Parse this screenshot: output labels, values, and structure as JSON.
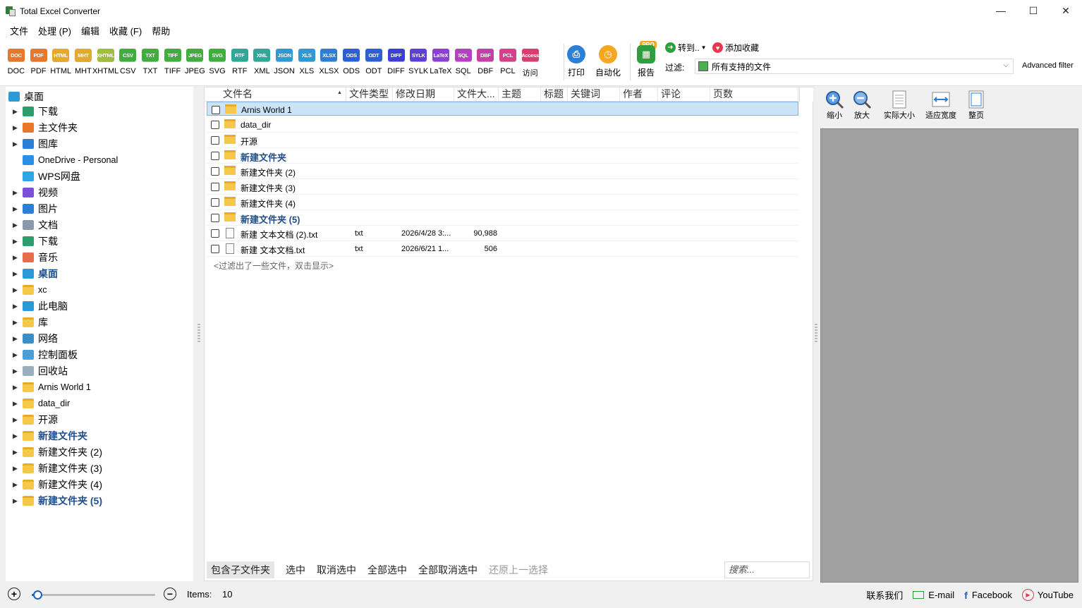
{
  "window": {
    "title": "Total Excel Converter",
    "minimize": "—",
    "maximize": "☐",
    "close": "✕"
  },
  "menu": [
    "文件",
    "处理 (P)",
    "编辑",
    "收藏 (F)",
    "帮助"
  ],
  "formats": [
    {
      "label": "DOC",
      "color": "#e8762b"
    },
    {
      "label": "PDF",
      "color": "#e8762b"
    },
    {
      "label": "HTML",
      "color": "#e8a82b"
    },
    {
      "label": "MHT",
      "color": "#e8a82b"
    },
    {
      "label": "XHTML",
      "color": "#9fbf3b"
    },
    {
      "label": "CSV",
      "color": "#3fae3f"
    },
    {
      "label": "TXT",
      "color": "#3fae3f"
    },
    {
      "label": "TIFF",
      "color": "#3fae3f"
    },
    {
      "label": "JPEG",
      "color": "#3fae3f"
    },
    {
      "label": "SVG",
      "color": "#3fae3f"
    },
    {
      "label": "RTF",
      "color": "#2fa89a"
    },
    {
      "label": "XML",
      "color": "#2fa89a"
    },
    {
      "label": "JSON",
      "color": "#2b9ad6"
    },
    {
      "label": "XLS",
      "color": "#2b9ad6"
    },
    {
      "label": "XLSX",
      "color": "#2b7fd6"
    },
    {
      "label": "ODS",
      "color": "#2b5fd6"
    },
    {
      "label": "ODT",
      "color": "#2b5fd6"
    },
    {
      "label": "DIFF",
      "color": "#3b3fd6"
    },
    {
      "label": "SYLK",
      "color": "#5b3fd6"
    },
    {
      "label": "LaTeX",
      "color": "#8b3fd6"
    },
    {
      "label": "SQL",
      "color": "#b63fc6"
    },
    {
      "label": "DBF",
      "color": "#c63fa6"
    },
    {
      "label": "PCL",
      "color": "#d63f8b"
    },
    {
      "label": "访问",
      "badge": "Access",
      "color": "#d63f6b"
    }
  ],
  "toolbar": {
    "print": "打印",
    "automate": "自动化",
    "report": "报告",
    "pro": "PRO",
    "goto": "转到..",
    "add_favorite": "添加收藏",
    "filter_label": "过滤:",
    "filter_value": "所有支持的文件",
    "advanced_filter": "Advanced filter"
  },
  "tree": {
    "root": "桌面",
    "items": [
      {
        "label": "下载",
        "icon": "download-icon",
        "color": "#2e9e6e",
        "arrow": true
      },
      {
        "label": "主文件夹",
        "icon": "home-icon",
        "color": "#e8762b",
        "arrow": true
      },
      {
        "label": "图库",
        "icon": "gallery-icon",
        "color": "#2b7fd6",
        "arrow": true
      },
      {
        "label": "OneDrive - Personal",
        "icon": "onedrive-icon",
        "color": "#2b8fe6",
        "arrow": false,
        "small": true
      },
      {
        "label": "WPS网盘",
        "icon": "cloud-icon",
        "color": "#2ba6e6",
        "arrow": false
      },
      {
        "label": "视频",
        "icon": "video-icon",
        "color": "#7b4fd6",
        "arrow": true
      },
      {
        "label": "图片",
        "icon": "pictures-icon",
        "color": "#2b7fd6",
        "arrow": true
      },
      {
        "label": "文档",
        "icon": "documents-icon",
        "color": "#8a9aaa",
        "arrow": true
      },
      {
        "label": "下载",
        "icon": "download-icon",
        "color": "#2e9e6e",
        "arrow": true
      },
      {
        "label": "音乐",
        "icon": "music-icon",
        "color": "#e86b4b",
        "arrow": true
      },
      {
        "label": "桌面",
        "icon": "desktop-icon",
        "color": "#2b9ad6",
        "arrow": true,
        "bold": true
      },
      {
        "label": "xc",
        "icon": "folder-icon",
        "color": "#f5c84a",
        "arrow": true,
        "small": true
      },
      {
        "label": "此电脑",
        "icon": "computer-icon",
        "color": "#2b9ad6",
        "arrow": true
      },
      {
        "label": "库",
        "icon": "folder-icon",
        "color": "#f5c84a",
        "arrow": true
      },
      {
        "label": "网络",
        "icon": "network-icon",
        "color": "#3b8fc6",
        "arrow": true
      },
      {
        "label": "控制面板",
        "icon": "control-panel-icon",
        "color": "#4b9fd6",
        "arrow": true
      },
      {
        "label": "回收站",
        "icon": "recycle-bin-icon",
        "color": "#9ab0c0",
        "arrow": true
      },
      {
        "label": "Arnis World 1",
        "icon": "folder-icon",
        "color": "#f5c84a",
        "arrow": true,
        "small": true
      },
      {
        "label": "data_dir",
        "icon": "folder-icon",
        "color": "#f5c84a",
        "arrow": true,
        "small": true
      },
      {
        "label": "开源",
        "icon": "folder-icon",
        "color": "#f5c84a",
        "arrow": true
      },
      {
        "label": "新建文件夹",
        "icon": "folder-icon",
        "color": "#f5c84a",
        "arrow": true,
        "bold": true
      },
      {
        "label": "新建文件夹 (2)",
        "icon": "folder-icon",
        "color": "#f5c84a",
        "arrow": true
      },
      {
        "label": "新建文件夹 (3)",
        "icon": "folder-icon",
        "color": "#f5c84a",
        "arrow": true
      },
      {
        "label": "新建文件夹 (4)",
        "icon": "folder-icon",
        "color": "#f5c84a",
        "arrow": true
      },
      {
        "label": "新建文件夹 (5)",
        "icon": "folder-icon",
        "color": "#f5c84a",
        "arrow": true,
        "bold": true
      }
    ]
  },
  "columns": [
    "文件名",
    "文件类型",
    "修改日期",
    "文件大...",
    "主题",
    "标题",
    "关键词",
    "作者",
    "评论",
    "页数"
  ],
  "files": [
    {
      "name": "Arnis World 1",
      "kind": "folder",
      "selected": true
    },
    {
      "name": "data_dir",
      "kind": "folder"
    },
    {
      "name": "开源",
      "kind": "folder"
    },
    {
      "name": "新建文件夹",
      "kind": "folder",
      "bold": true
    },
    {
      "name": "新建文件夹 (2)",
      "kind": "folder"
    },
    {
      "name": "新建文件夹 (3)",
      "kind": "folder"
    },
    {
      "name": "新建文件夹 (4)",
      "kind": "folder"
    },
    {
      "name": "新建文件夹 (5)",
      "kind": "folder",
      "bold": true
    },
    {
      "name": "新建 文本文档 (2).txt",
      "kind": "file",
      "type": "txt",
      "date": "2026/4/28 3:...",
      "size": "90,988"
    },
    {
      "name": "新建 文本文档.txt",
      "kind": "file",
      "type": "txt",
      "date": "2026/6/21 1...",
      "size": "506"
    }
  ],
  "filtered_notice": "<过滤出了一些文件，双击显示>",
  "bottom_actions": {
    "include_subfolders": "包含子文件夹",
    "select": "选中",
    "deselect": "取消选中",
    "select_all": "全部选中",
    "deselect_all": "全部取消选中",
    "restore_selection": "还原上一选择",
    "search_placeholder": "搜索..."
  },
  "preview": {
    "zoom_out": "缩小",
    "zoom_in": "放大",
    "actual_size": "实际大小",
    "fit_width": "适应宽度",
    "full_page": "整页"
  },
  "status": {
    "zoom_in": "+",
    "zoom_out": "−",
    "zoom_level": 0.03,
    "items_label": "Items:",
    "items_count": "10",
    "contact": "联系我们",
    "email": "E-mail",
    "facebook": "Facebook",
    "youtube": "YouTube"
  }
}
